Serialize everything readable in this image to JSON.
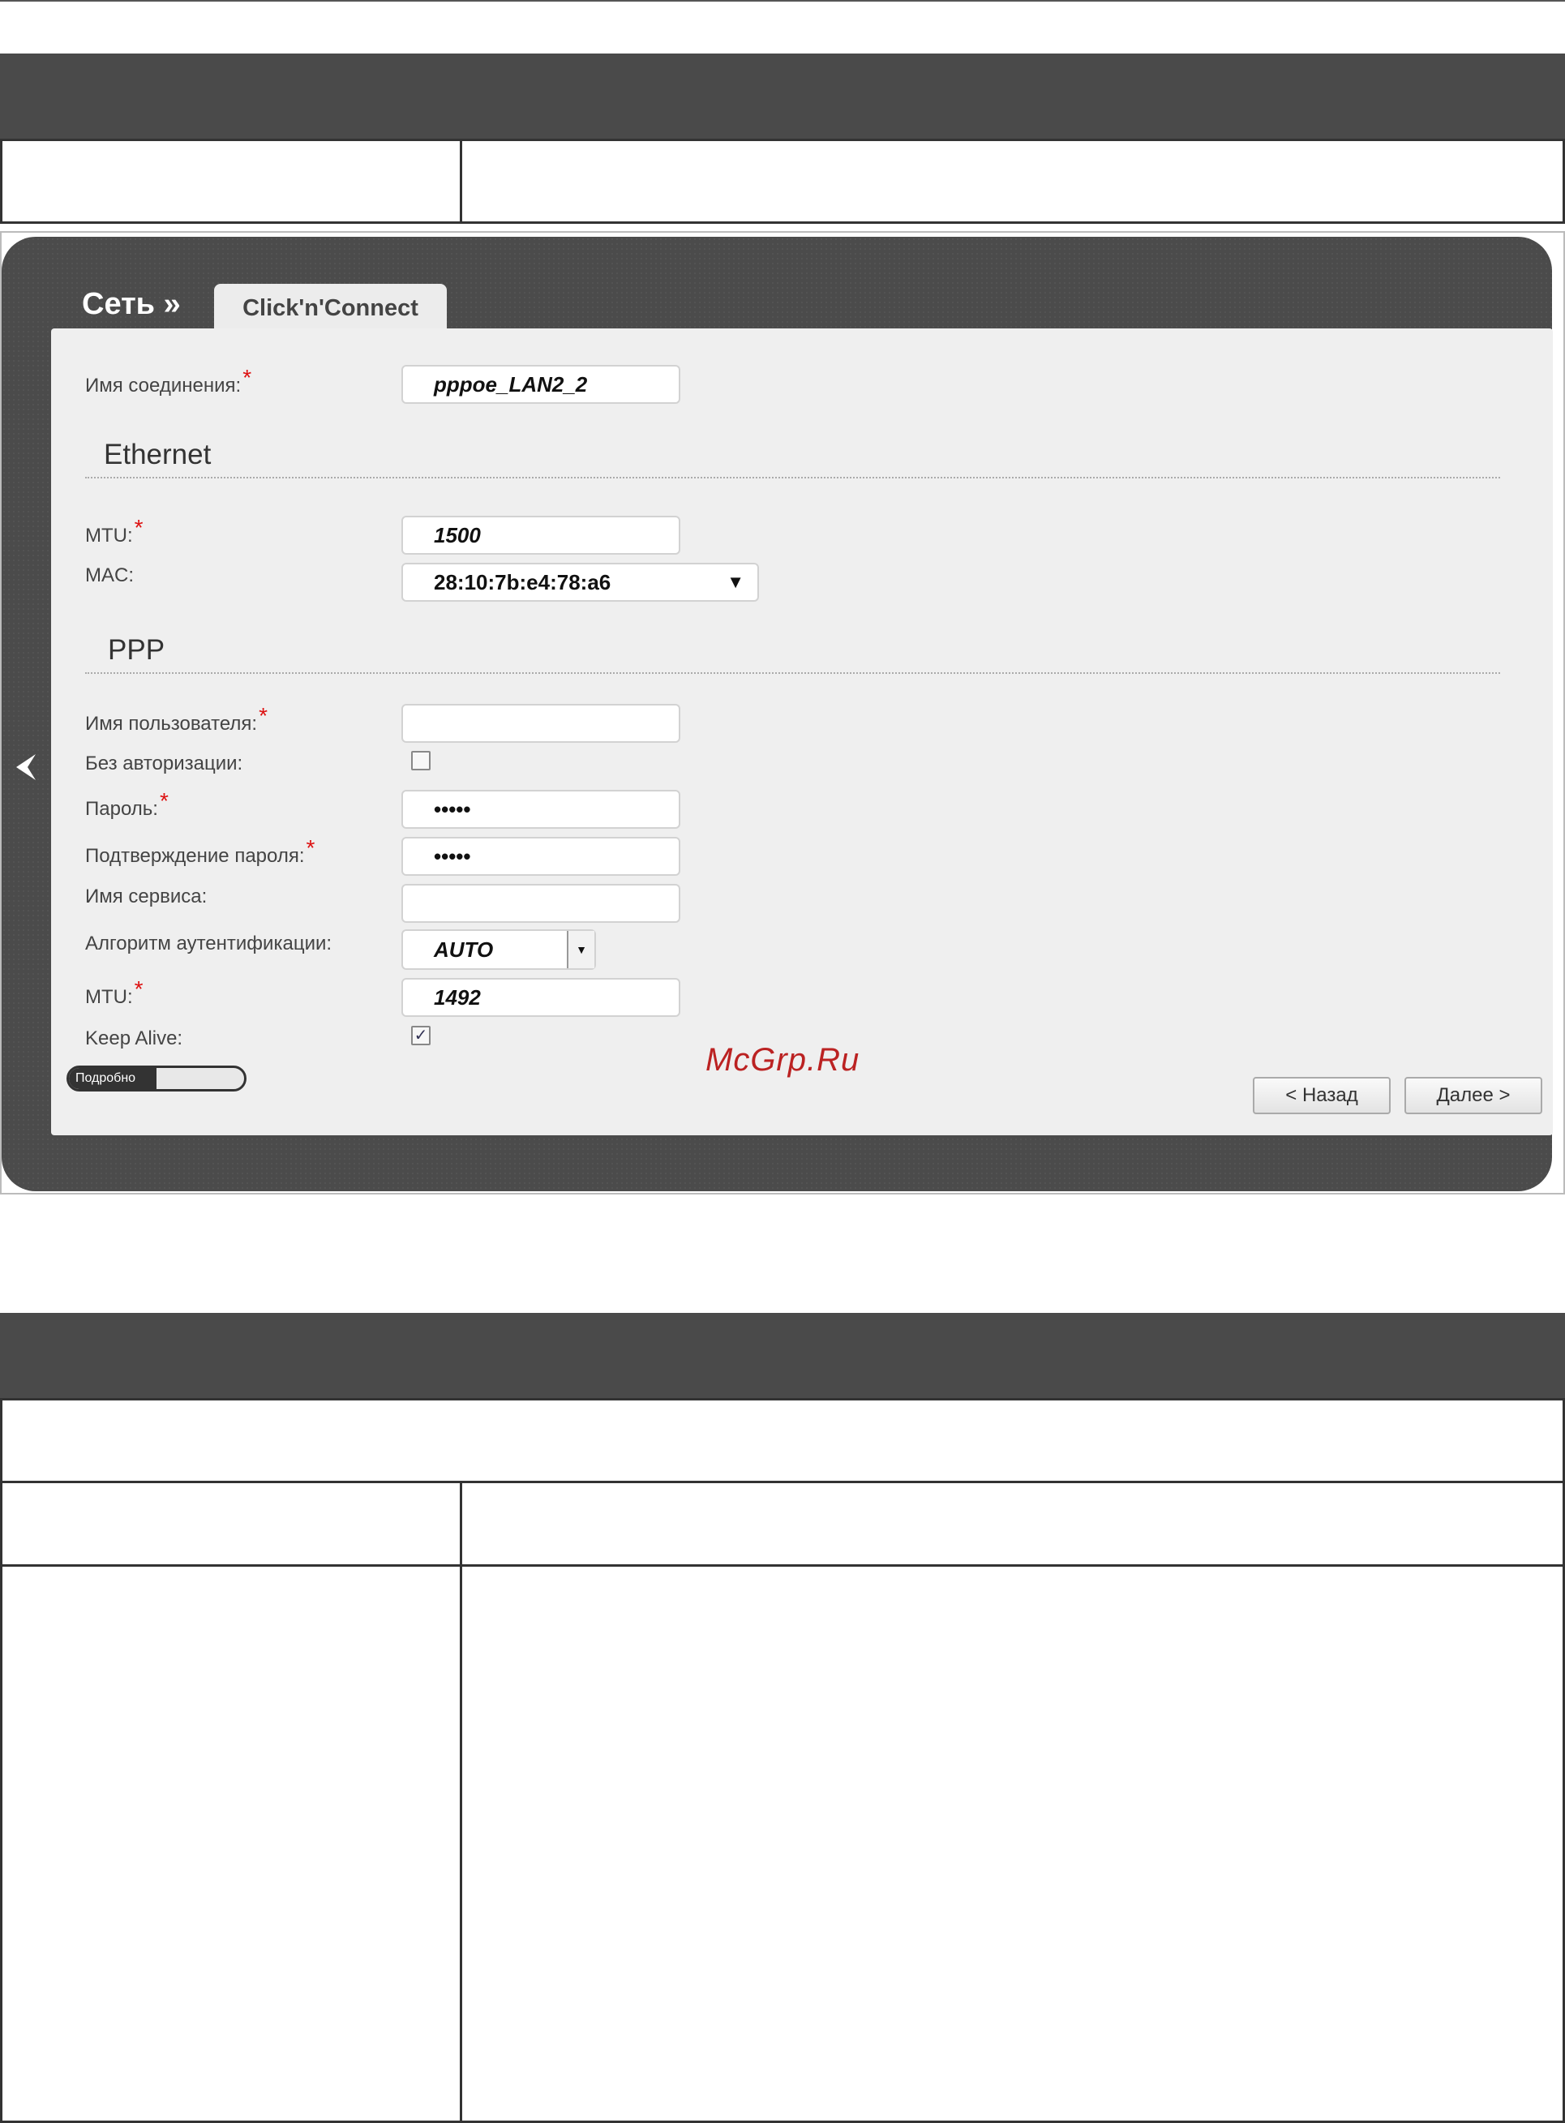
{
  "screen": {
    "section": "Сеть »",
    "tab": "Click'n'Connect",
    "connection_name": {
      "label": "Имя соединения:",
      "value": "pppoe_LAN2_2"
    },
    "ethernet": {
      "title": "Ethernet",
      "mtu": {
        "label": "MTU:",
        "value": "1500"
      },
      "mac": {
        "label": "MAC:",
        "value": "28:10:7b:e4:78:a6"
      }
    },
    "ppp": {
      "title": "PPP",
      "username": {
        "label": "Имя пользователя:",
        "value": ""
      },
      "no_auth": {
        "label": "Без авторизации:",
        "checked": false
      },
      "password": {
        "label": "Пароль:",
        "value": "•••••"
      },
      "password_confirm": {
        "label": "Подтверждение пароля:",
        "value": "•••••"
      },
      "service_name": {
        "label": "Имя сервиса:",
        "value": ""
      },
      "auth_algorithm": {
        "label": "Алгоритм аутентификации:",
        "value": "AUTO"
      },
      "mtu": {
        "label": "MTU:",
        "value": "1492"
      },
      "keep_alive": {
        "label": "Keep Alive:",
        "checked": true
      }
    },
    "required_mark": "*",
    "details_toggle": "Подробно",
    "back_button": "< Назад",
    "next_button": "Далее >",
    "watermark": "McGrp.Ru"
  }
}
